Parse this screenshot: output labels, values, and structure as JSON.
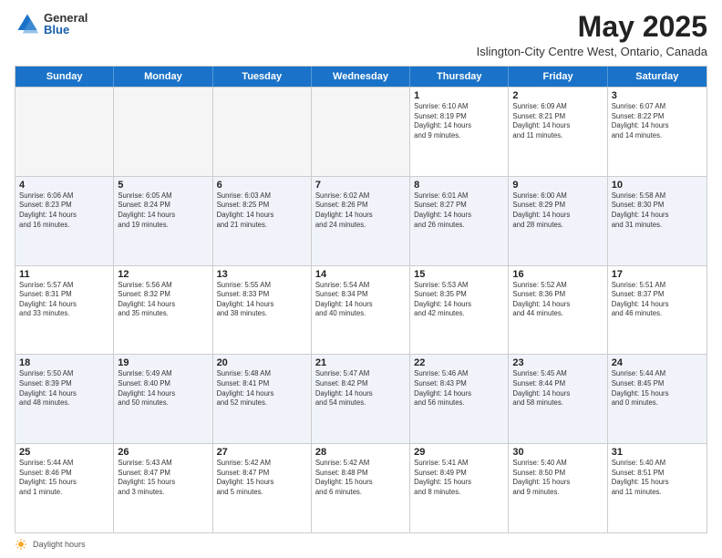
{
  "logo": {
    "general": "General",
    "blue": "Blue"
  },
  "title": "May 2025",
  "subtitle": "Islington-City Centre West, Ontario, Canada",
  "days": [
    "Sunday",
    "Monday",
    "Tuesday",
    "Wednesday",
    "Thursday",
    "Friday",
    "Saturday"
  ],
  "weeks": [
    [
      {
        "day": "",
        "content": ""
      },
      {
        "day": "",
        "content": ""
      },
      {
        "day": "",
        "content": ""
      },
      {
        "day": "",
        "content": ""
      },
      {
        "day": "1",
        "content": "Sunrise: 6:10 AM\nSunset: 8:19 PM\nDaylight: 14 hours\nand 9 minutes."
      },
      {
        "day": "2",
        "content": "Sunrise: 6:09 AM\nSunset: 8:21 PM\nDaylight: 14 hours\nand 11 minutes."
      },
      {
        "day": "3",
        "content": "Sunrise: 6:07 AM\nSunset: 8:22 PM\nDaylight: 14 hours\nand 14 minutes."
      }
    ],
    [
      {
        "day": "4",
        "content": "Sunrise: 6:06 AM\nSunset: 8:23 PM\nDaylight: 14 hours\nand 16 minutes."
      },
      {
        "day": "5",
        "content": "Sunrise: 6:05 AM\nSunset: 8:24 PM\nDaylight: 14 hours\nand 19 minutes."
      },
      {
        "day": "6",
        "content": "Sunrise: 6:03 AM\nSunset: 8:25 PM\nDaylight: 14 hours\nand 21 minutes."
      },
      {
        "day": "7",
        "content": "Sunrise: 6:02 AM\nSunset: 8:26 PM\nDaylight: 14 hours\nand 24 minutes."
      },
      {
        "day": "8",
        "content": "Sunrise: 6:01 AM\nSunset: 8:27 PM\nDaylight: 14 hours\nand 26 minutes."
      },
      {
        "day": "9",
        "content": "Sunrise: 6:00 AM\nSunset: 8:29 PM\nDaylight: 14 hours\nand 28 minutes."
      },
      {
        "day": "10",
        "content": "Sunrise: 5:58 AM\nSunset: 8:30 PM\nDaylight: 14 hours\nand 31 minutes."
      }
    ],
    [
      {
        "day": "11",
        "content": "Sunrise: 5:57 AM\nSunset: 8:31 PM\nDaylight: 14 hours\nand 33 minutes."
      },
      {
        "day": "12",
        "content": "Sunrise: 5:56 AM\nSunset: 8:32 PM\nDaylight: 14 hours\nand 35 minutes."
      },
      {
        "day": "13",
        "content": "Sunrise: 5:55 AM\nSunset: 8:33 PM\nDaylight: 14 hours\nand 38 minutes."
      },
      {
        "day": "14",
        "content": "Sunrise: 5:54 AM\nSunset: 8:34 PM\nDaylight: 14 hours\nand 40 minutes."
      },
      {
        "day": "15",
        "content": "Sunrise: 5:53 AM\nSunset: 8:35 PM\nDaylight: 14 hours\nand 42 minutes."
      },
      {
        "day": "16",
        "content": "Sunrise: 5:52 AM\nSunset: 8:36 PM\nDaylight: 14 hours\nand 44 minutes."
      },
      {
        "day": "17",
        "content": "Sunrise: 5:51 AM\nSunset: 8:37 PM\nDaylight: 14 hours\nand 46 minutes."
      }
    ],
    [
      {
        "day": "18",
        "content": "Sunrise: 5:50 AM\nSunset: 8:39 PM\nDaylight: 14 hours\nand 48 minutes."
      },
      {
        "day": "19",
        "content": "Sunrise: 5:49 AM\nSunset: 8:40 PM\nDaylight: 14 hours\nand 50 minutes."
      },
      {
        "day": "20",
        "content": "Sunrise: 5:48 AM\nSunset: 8:41 PM\nDaylight: 14 hours\nand 52 minutes."
      },
      {
        "day": "21",
        "content": "Sunrise: 5:47 AM\nSunset: 8:42 PM\nDaylight: 14 hours\nand 54 minutes."
      },
      {
        "day": "22",
        "content": "Sunrise: 5:46 AM\nSunset: 8:43 PM\nDaylight: 14 hours\nand 56 minutes."
      },
      {
        "day": "23",
        "content": "Sunrise: 5:45 AM\nSunset: 8:44 PM\nDaylight: 14 hours\nand 58 minutes."
      },
      {
        "day": "24",
        "content": "Sunrise: 5:44 AM\nSunset: 8:45 PM\nDaylight: 15 hours\nand 0 minutes."
      }
    ],
    [
      {
        "day": "25",
        "content": "Sunrise: 5:44 AM\nSunset: 8:46 PM\nDaylight: 15 hours\nand 1 minute."
      },
      {
        "day": "26",
        "content": "Sunrise: 5:43 AM\nSunset: 8:47 PM\nDaylight: 15 hours\nand 3 minutes."
      },
      {
        "day": "27",
        "content": "Sunrise: 5:42 AM\nSunset: 8:47 PM\nDaylight: 15 hours\nand 5 minutes."
      },
      {
        "day": "28",
        "content": "Sunrise: 5:42 AM\nSunset: 8:48 PM\nDaylight: 15 hours\nand 6 minutes."
      },
      {
        "day": "29",
        "content": "Sunrise: 5:41 AM\nSunset: 8:49 PM\nDaylight: 15 hours\nand 8 minutes."
      },
      {
        "day": "30",
        "content": "Sunrise: 5:40 AM\nSunset: 8:50 PM\nDaylight: 15 hours\nand 9 minutes."
      },
      {
        "day": "31",
        "content": "Sunrise: 5:40 AM\nSunset: 8:51 PM\nDaylight: 15 hours\nand 11 minutes."
      }
    ]
  ],
  "footer": {
    "daylight_label": "Daylight hours"
  }
}
